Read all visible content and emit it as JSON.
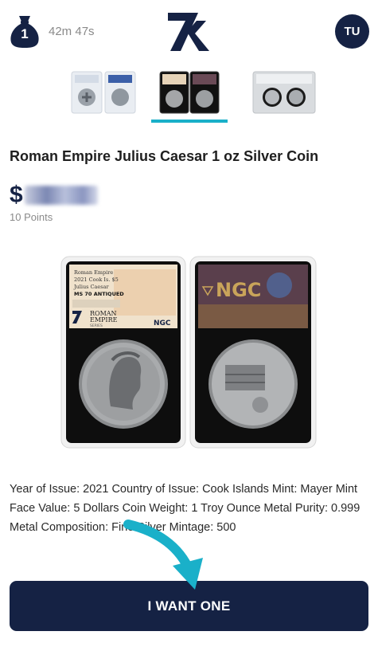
{
  "header": {
    "bag_count": "1",
    "timer": "42m 47s",
    "avatar_initials": "TU",
    "colors": {
      "navy": "#152244",
      "accent": "#1ab0c9"
    }
  },
  "thumbnails": [
    {
      "name": "thumb-coin-slab-white",
      "selected": false
    },
    {
      "name": "thumb-coin-slab-black",
      "selected": true
    },
    {
      "name": "thumb-coin-slab-grey",
      "selected": false
    }
  ],
  "product": {
    "title": "Roman Empire Julius Caesar 1 oz Silver Coin",
    "price_symbol": "$",
    "points": "10 Points",
    "label_left": {
      "line1": "Roman Empire",
      "line2": "2021 Cook Is. $5",
      "line3": "Julius Caesar",
      "line4": "MS 70 ANTIQUED",
      "brand": "ROMAN",
      "brand2": "EMPIRE",
      "brand3": "SERIES",
      "grader": "NGC"
    },
    "label_right": {
      "grader": "NGC"
    }
  },
  "specs": {
    "line1": "Year of Issue: 2021 Country of Issue: Cook Islands Mint: Mayer Mint",
    "line2": "Face Value: 5 Dollars Coin Weight: 1 Troy Ounce Metal Purity: 0.999",
    "line3": "Metal Composition: Fine Silver Mintage: 500"
  },
  "cta": {
    "label": "I WANT ONE"
  }
}
